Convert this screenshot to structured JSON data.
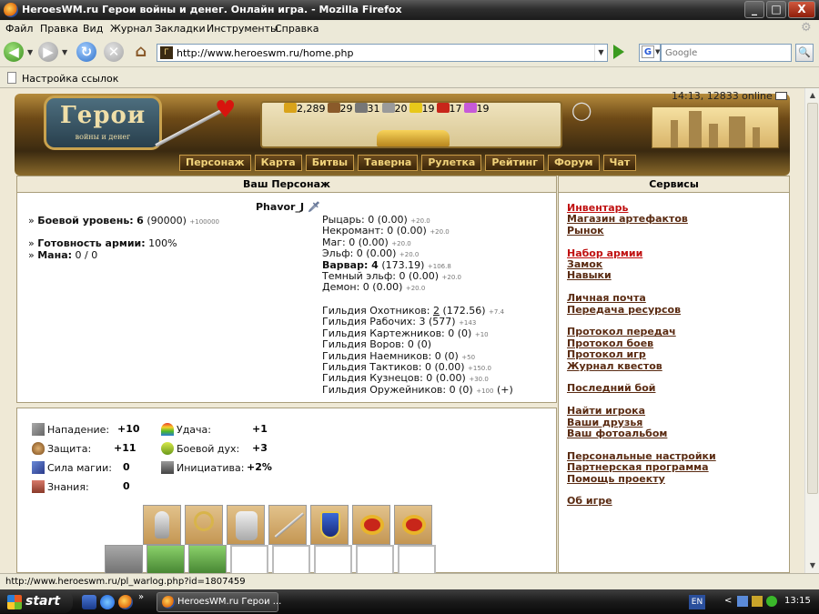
{
  "window": {
    "title": "HeroesWM.ru Герои войны и денег. Онлайн игра. - Mozilla Firefox",
    "min": "_",
    "max": "□",
    "close": "X"
  },
  "menu": [
    "Файл",
    "Правка",
    "Вид",
    "Журнал",
    "Закладки",
    "Инструменты",
    "Справка"
  ],
  "toolbar": {
    "url": "http://www.heroeswm.ru/home.php",
    "search_placeholder": "Google",
    "search_engine": "G"
  },
  "bookmarks": {
    "item": "Настройка ссылок"
  },
  "game": {
    "time_online": "14:13, 12833 online",
    "logo_big": "Герои",
    "logo_small": "войны и денег",
    "resources": [
      {
        "name": "gold",
        "value": "2,289",
        "color": "#d9a31a"
      },
      {
        "name": "wood",
        "value": "29",
        "color": "#8a5a2a"
      },
      {
        "name": "ore",
        "value": "31",
        "color": "#777777"
      },
      {
        "name": "mercury",
        "value": "20",
        "color": "#9a9a9a"
      },
      {
        "name": "sulfur",
        "value": "19",
        "color": "#e8c81a"
      },
      {
        "name": "crystals",
        "value": "17",
        "color": "#c8261a"
      },
      {
        "name": "gems",
        "value": "19",
        "color": "#c75ad8"
      }
    ],
    "nav": [
      "Персонаж",
      "Карта",
      "Битвы",
      "Таверна",
      "Рулетка",
      "Рейтинг",
      "Форум",
      "Чат"
    ]
  },
  "character_panel": {
    "header": "Ваш Персонаж",
    "name": "Phavor_J",
    "combat_level_label": "Боевой уровень:",
    "combat_level": "6",
    "combat_level_exp": "(90000)",
    "combat_level_next": "+100000",
    "army_ready_label": "Готовность армии:",
    "army_ready": "100%",
    "mana_label": "Мана:",
    "mana": "0 / 0",
    "factions": [
      {
        "label": "Рыцарь: 0 (0.00)",
        "extra": "+20.0",
        "bold": false
      },
      {
        "label": "Некромант: 0 (0.00)",
        "extra": "+20.0",
        "bold": false
      },
      {
        "label": "Маг: 0 (0.00)",
        "extra": "+20.0",
        "bold": false
      },
      {
        "label": "Эльф: 0 (0.00)",
        "extra": "+20.0",
        "bold": false
      },
      {
        "label": "Варвар: 4",
        "label_rest": " (173.19)",
        "extra": "+106.8",
        "bold": true
      },
      {
        "label": "Темный эльф: 0 (0.00)",
        "extra": "+20.0",
        "bold": false
      },
      {
        "label": "Демон: 0 (0.00)",
        "extra": "+20.0",
        "bold": false
      }
    ],
    "guilds": [
      {
        "label": "Гильдия Охотников: ",
        "level": "2",
        "rest": " (172.56)",
        "extra": "+7.4"
      },
      {
        "label": "Гильдия Рабочих: 3 (577)",
        "level": "",
        "rest": "",
        "extra": "+143"
      },
      {
        "label": "Гильдия Картежников: 0 (0)",
        "level": "",
        "rest": "",
        "extra": "+10"
      },
      {
        "label": "Гильдия Воров: 0 (0)",
        "level": "",
        "rest": "",
        "extra": ""
      },
      {
        "label": "Гильдия Наемников: 0 (0)",
        "level": "",
        "rest": "",
        "extra": "+50"
      },
      {
        "label": "Гильдия Тактиков: 0 (0.00)",
        "level": "",
        "rest": "",
        "extra": "+150.0"
      },
      {
        "label": "Гильдия Кузнецов: 0 (0.00)",
        "level": "",
        "rest": "",
        "extra": "+30.0"
      },
      {
        "label": "Гильдия Оружейников: 0 (0)",
        "level": "",
        "rest": "",
        "extra": "+100",
        "plus": "(+)"
      }
    ]
  },
  "services": {
    "header": "Сервисы",
    "groups": [
      [
        {
          "label": "Инвентарь",
          "red": true
        },
        {
          "label": "Магазин артефактов"
        },
        {
          "label": "Рынок"
        }
      ],
      [
        {
          "label": "Набор армии",
          "red": true
        },
        {
          "label": "Замок"
        },
        {
          "label": "Навыки"
        }
      ],
      [
        {
          "label": "Личная почта"
        },
        {
          "label": "Передача ресурсов"
        }
      ],
      [
        {
          "label": "Протокол передач"
        },
        {
          "label": "Протокол боев"
        },
        {
          "label": "Протокол игр"
        },
        {
          "label": "Журнал квестов"
        }
      ],
      [
        {
          "label": "Последний бой"
        }
      ],
      [
        {
          "label": "Найти игрока"
        },
        {
          "label": "Ваши друзья"
        },
        {
          "label": "Ваш фотоальбом"
        }
      ],
      [
        {
          "label": "Персональные настройки"
        },
        {
          "label": "Партнерская программа"
        },
        {
          "label": "Помощь проекту"
        }
      ],
      [
        {
          "label": "Об игре"
        }
      ]
    ]
  },
  "stats": {
    "attack_label": "Нападение:",
    "attack": "+10",
    "defense_label": "Защита:",
    "defense": "+11",
    "spellpower_label": "Сила магии:",
    "spellpower": "0",
    "knowledge_label": "Знания:",
    "knowledge": "0",
    "luck_label": "Удача:",
    "luck": "+1",
    "morale_label": "Боевой дух:",
    "morale": "+3",
    "initiative_label": "Инициатива:",
    "initiative": "+2%"
  },
  "status_bar": "http://www.heroeswm.ru/pl_warlog.php?id=1807459",
  "taskbar": {
    "start": "start",
    "task": "HeroesWM.ru Герои ...",
    "lang": "EN",
    "clock": "13:15"
  }
}
